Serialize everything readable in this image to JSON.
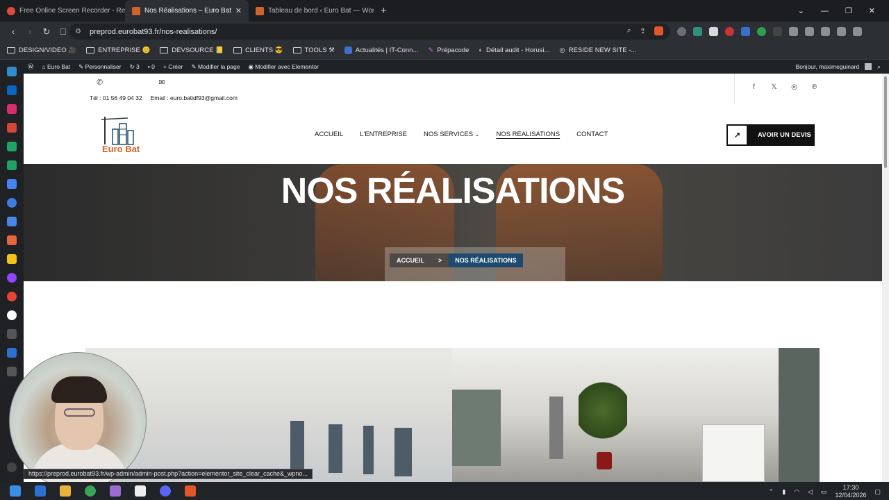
{
  "browser": {
    "tabs": [
      {
        "label": "Free Online Screen Recorder - Re",
        "active": false,
        "favicon_color": "#e14a3b"
      },
      {
        "label": "Nos Réalisations – Euro Bat",
        "active": true,
        "favicon_color": "#d1632a"
      },
      {
        "label": "Tableau de bord ‹ Euro Bat — WordP",
        "active": false,
        "favicon_color": "#d1632a"
      }
    ],
    "new_tab": "+",
    "url": "preprod.eurobat93.fr/nos-realisations/",
    "bookmarks": [
      {
        "label": "DESIGN/VIDEO 🎥",
        "type": "folder"
      },
      {
        "label": "ENTREPRISE 😊",
        "type": "folder"
      },
      {
        "label": "DEVSOURCE 📒",
        "type": "folder"
      },
      {
        "label": "CLIENTS 😎",
        "type": "folder"
      },
      {
        "label": "TOOLS ⚒",
        "type": "folder"
      },
      {
        "label": "Actualités | IT-Conn...",
        "type": "link"
      },
      {
        "label": "Prépacode",
        "type": "link"
      },
      {
        "label": "Détail audit - Horusi...",
        "type": "link"
      },
      {
        "label": "RESIDE NEW SITE -...",
        "type": "link"
      }
    ],
    "status_url": "https://preprod.eurobat93.fr/wp-admin/admin-post.php?action=elementor_site_clear_cache&_wpno..."
  },
  "wpbar": {
    "site": "Euro Bat",
    "customize": "Personnaliser",
    "updates": "3",
    "comments": "0",
    "new": "Créer",
    "edit_page": "Modifier la page",
    "edit_elementor": "Modifier avec Elementor",
    "greeting": "Bonjour, maximeguinard"
  },
  "site": {
    "phone": "Tél : 01 56 49 04 32",
    "email": "Email : euro.batidf93@gmail.com",
    "logo_text": "Euro Bat",
    "nav": [
      {
        "label": "ACCUEIL",
        "active": false
      },
      {
        "label": "L'ENTREPRISE",
        "active": false
      },
      {
        "label": "NOS SERVICES",
        "active": false,
        "dropdown": true
      },
      {
        "label": "NOS RÉALISATIONS",
        "active": true
      },
      {
        "label": "CONTACT",
        "active": false
      }
    ],
    "dropdown_glyph": "⌄",
    "cta": "AVOIR UN DEVIS",
    "cta_icon": "↗",
    "hero_title": "NOS RÉALISATIONS",
    "breadcrumb": {
      "home": "ACCUEIL",
      "separator": ">",
      "current": "NOS RÉALISATIONS"
    },
    "social": [
      "facebook-icon",
      "x-icon",
      "instagram-icon",
      "pinterest-icon"
    ]
  },
  "taskbar": {
    "time": "17:30",
    "date": "12/04/2026"
  },
  "colors": {
    "accent_orange": "#d1632a",
    "breadcrumb_active": "#1d4a6e",
    "wp_admin_bar": "#1d2327"
  }
}
